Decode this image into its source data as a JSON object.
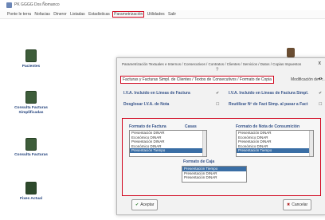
{
  "window": {
    "title": "PK GGGG Dos Ñomanco"
  },
  "menubar": {
    "items": [
      {
        "label": "Ponte le terra"
      },
      {
        "label": "Nofacias"
      },
      {
        "label": "Dineror"
      },
      {
        "label": "Listadas"
      },
      {
        "label": "Estadisticas"
      },
      {
        "label": "Parametrización"
      },
      {
        "label": "Utilidades"
      },
      {
        "label": "Salir"
      }
    ],
    "active_label": "Parametrización"
  },
  "desktop": {
    "icons": [
      {
        "label": "Pacientes"
      },
      {
        "label": "Consulta Facturas Simplificadas"
      },
      {
        "label": "Consulta Facturas"
      },
      {
        "label": "Fixes Actual"
      }
    ]
  },
  "dialog": {
    "title": "Parametrización Textuales e Internos / Consecutivos / Contratos / Clientes / Servicios / Datos / Copias Impuestos",
    "help": "?",
    "close": "x",
    "tab_selected": "Facturas y Facturas Simpl. de Clientes / Textos de Consecutivos / Formato de Copia",
    "tab_next": "Modificación de F...",
    "tab_arrows": "◂ ▸",
    "options": [
      {
        "label": "I.V.A. Incluido en Líneas de Factura",
        "check": "✔"
      },
      {
        "label": "I.V.A. Incluido en Líneas de Factura Simpl.",
        "check": "✔"
      },
      {
        "label": "Desglosar I.V.A. de Nota",
        "check": "☐"
      },
      {
        "label": "Reutilizar Nº de Fact Simp. al pasar a Fact",
        "check": "☐"
      }
    ],
    "formato_factura": {
      "label": "Formato de Factura",
      "label2": "Casas",
      "items": [
        "Presentación DINAR",
        "Económico DINAR",
        "Presentación DINAR",
        "Económico DINAR",
        "Presentación Tiempo"
      ],
      "selected_index": 4
    },
    "formato_nota": {
      "label": "Formato de Nota de Consumición",
      "items": [
        "Presentación DINAR",
        "Económico DINAR",
        "Presentación DINAR",
        "Económico DINAR",
        "Presentación Tiempo"
      ],
      "selected_index": 4
    },
    "formato_caja": {
      "label": "Formato de Caja",
      "items": [
        "Presentación Tiempo",
        "Presentación DINAR",
        "Presentación DINAR"
      ],
      "selected_index": 0
    },
    "accept_label": "Aceptar",
    "cancel_label": "Cancelar"
  }
}
